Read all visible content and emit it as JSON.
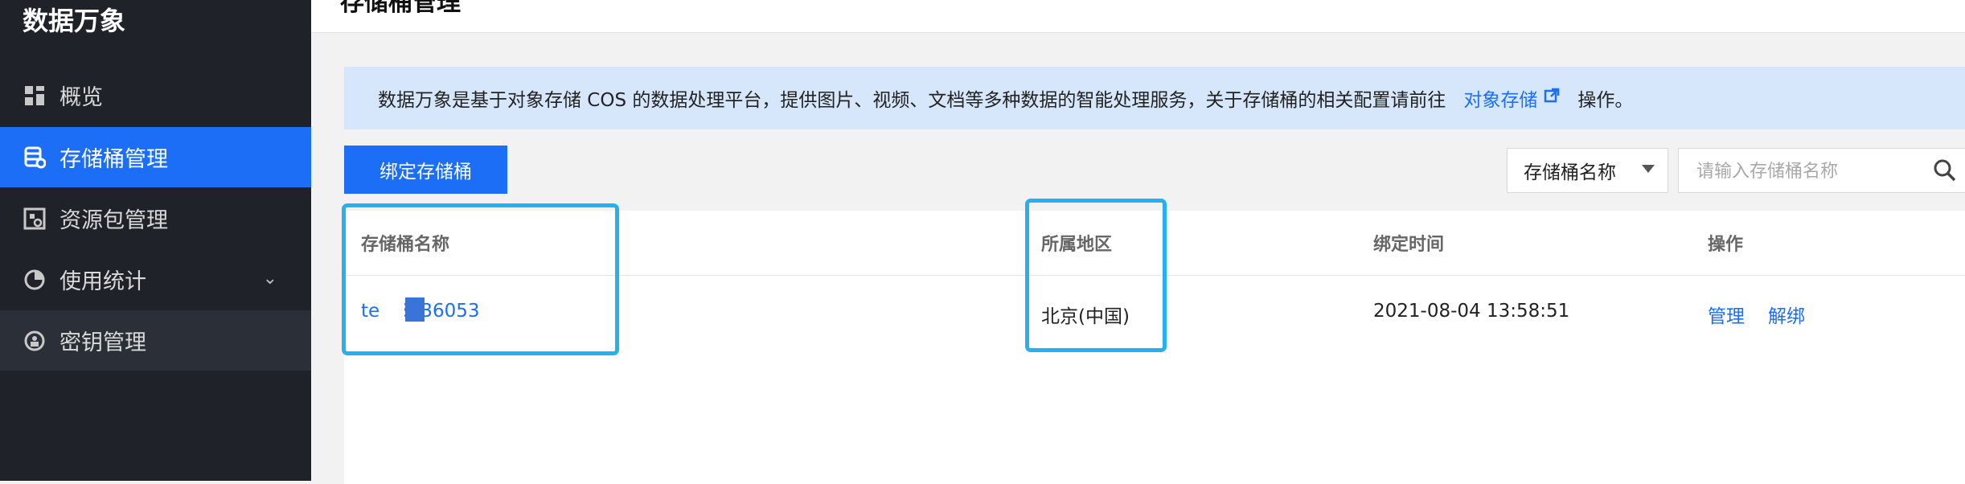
{
  "sidebar": {
    "brand": "数据万象",
    "items": [
      {
        "label": "概览",
        "icon": "dashboard-icon"
      },
      {
        "label": "存储桶管理",
        "icon": "bucket-icon"
      },
      {
        "label": "资源包管理",
        "icon": "package-icon"
      },
      {
        "label": "使用统计",
        "icon": "pie-chart-icon"
      },
      {
        "label": "密钥管理",
        "icon": "key-icon"
      }
    ]
  },
  "header": {
    "title": "存储桶管理"
  },
  "banner": {
    "text": "数据万象是基于对象存储 COS 的数据处理平台，提供图片、视频、文档等多种数据的智能处理服务，关于存储桶的相关配置请前往",
    "link": "对象存储",
    "after": "操作。"
  },
  "toolbar": {
    "bind_button": "绑定存储桶",
    "filter_selected": "存储桶名称",
    "search_placeholder": "请输入存储桶名称"
  },
  "table": {
    "headers": [
      "存储桶名称",
      "所属地区",
      "绑定时间",
      "操作"
    ],
    "rows": [
      {
        "name": "te     53136053",
        "region": "北京(中国)",
        "bind_time": "2021-08-04 13:58:51",
        "actions": [
          "管理",
          "解绑"
        ]
      }
    ]
  },
  "colors": {
    "accent": "#1c6ef6",
    "highlight": "#25b1f0",
    "sidebar_bg": "#1f2329"
  }
}
